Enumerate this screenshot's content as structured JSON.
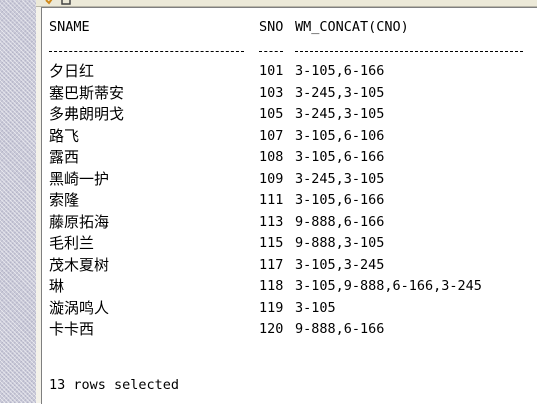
{
  "query_result": {
    "headers": {
      "sname": "SNAME",
      "sno": "SNO",
      "cno": "WM_CONCAT(CNO)"
    },
    "rows": [
      {
        "sname": "夕日红",
        "sno": "101",
        "cno": "3-105,6-166"
      },
      {
        "sname": "塞巴斯蒂安",
        "sno": "103",
        "cno": "3-245,3-105"
      },
      {
        "sname": "多弗朗明戈",
        "sno": "105",
        "cno": "3-245,3-105"
      },
      {
        "sname": "路飞",
        "sno": "107",
        "cno": "3-105,6-106"
      },
      {
        "sname": "露西",
        "sno": "108",
        "cno": "3-105,6-166"
      },
      {
        "sname": "黑崎一护",
        "sno": "109",
        "cno": "3-245,3-105"
      },
      {
        "sname": "索隆",
        "sno": "111",
        "cno": "3-105,6-166"
      },
      {
        "sname": "藤原拓海",
        "sno": "113",
        "cno": "9-888,6-166"
      },
      {
        "sname": "毛利兰",
        "sno": "115",
        "cno": "9-888,3-105"
      },
      {
        "sname": "茂木夏树",
        "sno": "117",
        "cno": "3-105,3-245"
      },
      {
        "sname": "琳",
        "sno": "118",
        "cno": "3-105,9-888,6-166,3-245"
      },
      {
        "sname": "漩涡鸣人",
        "sno": "119",
        "cno": "3-105"
      },
      {
        "sname": "卡卡西",
        "sno": "120",
        "cno": "9-888,6-166"
      }
    ],
    "footer": "13 rows selected"
  },
  "toolbar": {
    "icons": [
      "run-icon",
      "clear-icon"
    ]
  }
}
